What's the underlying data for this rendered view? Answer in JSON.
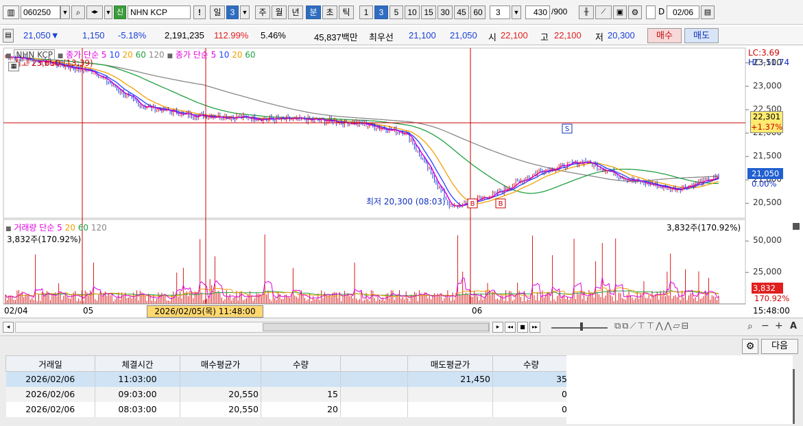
{
  "toolbar": {
    "stock_code": "060250",
    "stock_badge": "신",
    "stock_name": "NHN KCP",
    "period_buttons": [
      "일",
      "3",
      "주",
      "월",
      "년",
      "분",
      "초",
      "틱"
    ],
    "interval_buttons": [
      "1",
      "3",
      "5",
      "10",
      "15",
      "30",
      "45",
      "60"
    ],
    "interval_value": "3",
    "count_value": "430",
    "count_total": "/900",
    "date_checkbox_label": "D",
    "date_value": "02/06"
  },
  "quote": {
    "price": "21,050▼",
    "change": "1,150",
    "change_pct": "-5.18%",
    "volume": "2,191,235",
    "volume_ratio": "112.99%",
    "turnover": "5.46%",
    "amount": "45,837백만",
    "best_label": "최우선",
    "ask": "21,100",
    "bid": "21,050",
    "open_label": "시",
    "open": "22,100",
    "high_label": "고",
    "high": "22,100",
    "low_label": "저",
    "low": "20,300",
    "buy_label": "매수",
    "sell_label": "매도"
  },
  "chart": {
    "price_legend": {
      "prefix": "NHN KCP",
      "ma1": "종가 단순 5",
      "ma2": "10",
      "ma3": "20",
      "ma4": "60",
      "ma5": "120",
      "sep_label": "종가 단순 5",
      "p2": "10",
      "p3": "20",
      "p4": "60"
    },
    "high_marker": "최고 23,650 (13:39)",
    "low_marker": "최저 20,300 (08:03)",
    "buy_marker": "B",
    "sell_marker": "S",
    "lc_label": "LC:3.69",
    "hc_label": "HC:-11.74",
    "cross_price": "22,301",
    "cross_pct": "+1.37%",
    "current_price": "21,050",
    "current_pct": "0.00%",
    "price_ticks": [
      "23,500",
      "23,000",
      "22,500",
      "22,000",
      "21,500",
      "21,000",
      "20,500"
    ],
    "volume_legend": {
      "title": "거래량 단순 5",
      "m2": "20",
      "m3": "60",
      "m4": "120",
      "readout": "3,832주(170.92%)"
    },
    "volume_ticks": [
      "50,000",
      "25,000"
    ],
    "volume_current": "3,832",
    "volume_current_pct": "170.92%",
    "x_labels": [
      "02/04",
      "05",
      "06"
    ],
    "cursor_label": "2026/02/05(목) 11:48:00",
    "time_end_label": "15:48:00"
  },
  "colors": {
    "price_line": "#1a1acc",
    "ma5": "#e000e0",
    "ma10": "#2040ff",
    "ma20": "#f0a000",
    "ma60": "#20a040",
    "ma120": "#888888",
    "crosshair": "#cc0000",
    "volume": "#d81818"
  },
  "chart_data": {
    "type": "line",
    "title": "NHN KCP",
    "x": [
      "02/04",
      "05",
      "06"
    ],
    "series": [
      {
        "name": "종가",
        "values": [
          23650,
          23500,
          23300,
          22600,
          22400,
          22350,
          22300,
          22280,
          22200,
          22000,
          20400,
          20700,
          21200,
          21400,
          21000,
          20800,
          21050
        ]
      }
    ],
    "y_range": [
      20300,
      23700
    ],
    "volume_series": [
      {
        "name": "거래량",
        "max": 60000
      }
    ]
  },
  "panel": {
    "settings_icon": "gear",
    "next_label": "다음",
    "columns": [
      "거래일",
      "체결시간",
      "매수평균가",
      "수량",
      "",
      "매도평균가",
      "수량"
    ],
    "rows": [
      [
        "2026/02/06",
        "11:03:00",
        "",
        "",
        "",
        "21,450",
        "35"
      ],
      [
        "2026/02/06",
        "09:03:00",
        "20,550",
        "15",
        "",
        "",
        "0"
      ],
      [
        "2026/02/06",
        "08:03:00",
        "20,550",
        "20",
        "",
        "",
        "0"
      ]
    ]
  }
}
